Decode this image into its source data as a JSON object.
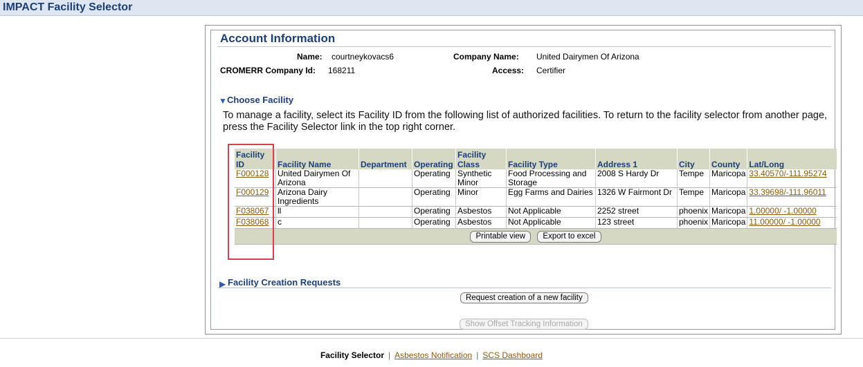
{
  "app": {
    "title": "IMPACT Facility Selector"
  },
  "account": {
    "title": "Account Information",
    "name_label": "Name:",
    "name_value": "courtneykovacs6",
    "company_label": "Company Name:",
    "company_value": "United Dairymen Of Arizona",
    "cromerr_label": "CROMERR Company Id:",
    "cromerr_value": "168211",
    "access_label": "Access:",
    "access_value": "Certifier"
  },
  "choose": {
    "title": "Choose Facility",
    "expanded": true,
    "instructions": "To manage a facility, select its Facility ID from the following list of authorized facilities. To return to the facility selector from another page, press the Facility Selector link in the top right corner."
  },
  "table": {
    "headers": [
      "Facility ID",
      "Facility Name",
      "Department",
      "Operating",
      "Facility Class",
      "Facility Type",
      "Address 1",
      "City",
      "County",
      "Lat/Long"
    ],
    "rows": [
      {
        "id": "F000128",
        "name": "United Dairymen Of Arizona",
        "dept": "",
        "op": "Operating",
        "cls": "Synthetic Minor",
        "type": "Food Processing and Storage",
        "addr": "2008 S Hardy Dr",
        "city": "Tempe",
        "county": "Maricopa",
        "latlong": "33.40570/-111.95274"
      },
      {
        "id": "F000129",
        "name": "Arizona Dairy Ingredients",
        "dept": "",
        "op": "Operating",
        "cls": "Minor",
        "type": "Egg Farms and Dairies",
        "addr": "1326 W Fairmont Dr",
        "city": "Tempe",
        "county": "Maricopa",
        "latlong": "33.39698/-111.96011"
      },
      {
        "id": "F038067",
        "name": "ll",
        "dept": "",
        "op": "Operating",
        "cls": "Asbestos",
        "type": "Not Applicable",
        "addr": "2252 street",
        "city": "phoenix",
        "county": "Maricopa",
        "latlong": "1.00000/ -1.00000"
      },
      {
        "id": "F038068",
        "name": "c",
        "dept": "",
        "op": "Operating",
        "cls": "Asbestos",
        "type": "Not Applicable",
        "addr": "123 street",
        "city": "phoenix",
        "county": "Maricopa",
        "latlong": "11.00000/ -1.00000"
      }
    ],
    "printable_label": "Printable view",
    "export_label": "Export to excel"
  },
  "creation": {
    "title": "Facility Creation Requests",
    "expanded": false,
    "request_label": "Request creation of a new facility",
    "offset_label": "Show Offset Tracking Information"
  },
  "footer": {
    "current": "Facility Selector",
    "links": [
      "Asbestos Notification",
      "SCS Dashboard"
    ],
    "separator": "|"
  },
  "colors": {
    "title_blue": "#1d3f77",
    "header_bg": "#d5d9c3",
    "link": "#8a5a0a",
    "highlight": "#d6424a"
  },
  "icons": {
    "expanded": "triangle-down-icon",
    "collapsed": "triangle-right-icon"
  }
}
